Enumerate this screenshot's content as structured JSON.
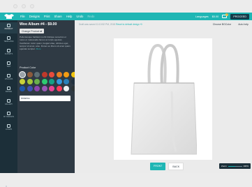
{
  "window": {},
  "topbar": {
    "menu": [
      "File",
      "Designs",
      "Print",
      "Share",
      "Help",
      "Undo",
      "Redo"
    ],
    "language": "Languages",
    "price": "$0.00",
    "cart_count": "1",
    "proceed": "PROCEED",
    "bg": "#1fb6b4"
  },
  "sidenav": {
    "items": [
      {
        "label": "PRODUCT",
        "icon": "shirt-icon"
      },
      {
        "label": "TEMPLATES",
        "icon": "templates-icon"
      },
      {
        "label": "CLIPARTS",
        "icon": "heart-icon"
      },
      {
        "label": "TEXT",
        "icon": "text-icon"
      },
      {
        "label": "UPLOADS",
        "icon": "upload-icon"
      },
      {
        "label": "IMAGES",
        "icon": "image-icon"
      },
      {
        "label": "GALLERY",
        "icon": "gallery-icon"
      },
      {
        "label": "MY DESIGNS",
        "icon": "designs-icon"
      },
      {
        "label": "LAYERS",
        "icon": "layers-icon"
      }
    ]
  },
  "panel": {
    "title": "Woo Album #4 - $9.00",
    "change_product": "Change Product ⇄",
    "description": "Pellentesque habitant morbi tristique senectus et netus et malesuada fames ac turpis egestas. Vestibulum tortor quam, feugiat vitae, ultricies eget, tempor sit amet, ante. Donec eu libero sit amet quam egestas semper.",
    "more": "More",
    "color_label": "Product Color",
    "colors": [
      "#9aa3a9",
      "#8c5a3c",
      "#5d6f75",
      "#c0392b",
      "#e74c3c",
      "#e67e22",
      "#f39c12",
      "#f1c40f",
      "#c9d23a",
      "#a3c639",
      "#6ab04c",
      "#2ecc71",
      "#16a085",
      "#3498db",
      "#2980b9",
      "#22313f",
      "#1e57a8",
      "#3f51b5",
      "#8e44ad",
      "#9b59b6",
      "#e84393",
      "#ff3b5c",
      "#ecf0f1",
      "#2d3436"
    ],
    "selected_color_name": "Antonino"
  },
  "workspace": {
    "hint": "Draft was saved 11:10:52 PM, 2018",
    "reset": "Reset to default design ⟲",
    "clear": "Clear All",
    "choose_bgcolor": "Choose BGColor",
    "auto_help": "Auto help",
    "front": "FRONT",
    "back": "BACK",
    "zoom_label": "Zoom",
    "zoom_value": "100%",
    "zoom_level": 0.5
  }
}
